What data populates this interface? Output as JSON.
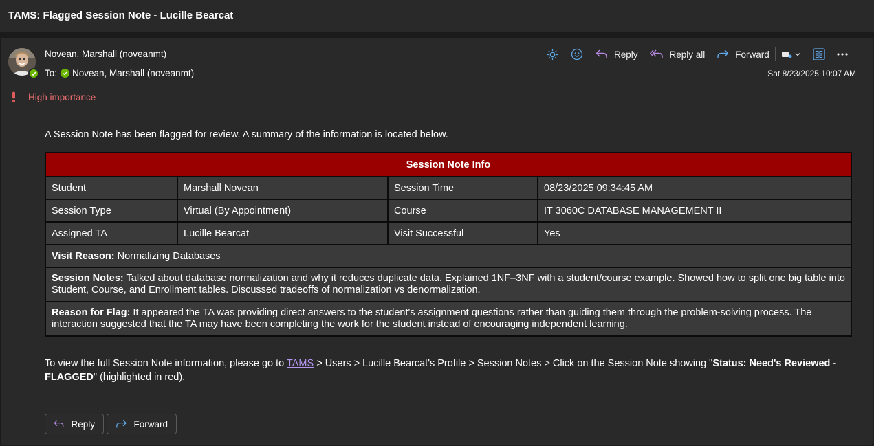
{
  "window": {
    "title": "TAMS: Flagged Session Note - Lucille Bearcat"
  },
  "message": {
    "sender": "Novean, Marshall (noveanmt)",
    "to_label": "To:",
    "recipient": "Novean, Marshall (noveanmt)",
    "date": "Sat 8/23/2025 10:07 AM",
    "importance": "High importance"
  },
  "toolbar": {
    "reply": "Reply",
    "reply_all": "Reply all",
    "forward": "Forward"
  },
  "body": {
    "intro": "A Session Note has been flagged for review. A summary of the information is located below.",
    "table_title": "Session Note Info",
    "rows": [
      {
        "l1": "Student",
        "v1": "Marshall Novean",
        "l2": "Session Time",
        "v2": "08/23/2025 09:34:45 AM"
      },
      {
        "l1": "Session Type",
        "v1": "Virtual (By Appointment)",
        "l2": "Course",
        "v2": "IT 3060C DATABASE MANAGEMENT II"
      },
      {
        "l1": "Assigned TA",
        "v1": "Lucille Bearcat",
        "l2": "Visit Successful",
        "v2": "Yes"
      }
    ],
    "visit_reason_label": "Visit Reason:",
    "visit_reason": " Normalizing Databases",
    "session_notes_label": "Session Notes:",
    "session_notes": " Talked about database normalization and why it reduces duplicate data. Explained 1NF–3NF with a student/course example. Showed how to split one big table into Student, Course, and Enrollment tables. Discussed tradeoffs of normalization vs denormalization.",
    "flag_reason_label": "Reason for Flag:",
    "flag_reason": " It appeared the TA was providing direct answers to the student's assignment questions rather than guiding them through the problem-solving process. The interaction suggested that the TA may have been completing the work for the student instead of encouraging independent learning.",
    "footer_prefix": "To view the full Session Note information, please go to ",
    "footer_link": "TAMS",
    "footer_mid": " > Users > Lucille Bearcat's Profile > Session Notes > Click on the Session Note showing \"",
    "footer_bold": "Status: Need's Reviewed - FLAGGED",
    "footer_suffix": "\" (highlighted in red)."
  },
  "actions": {
    "reply": "Reply",
    "forward": "Forward"
  },
  "colors": {
    "table_header": "#9b0000",
    "importance": "#ee6f6f",
    "link": "#b596f0",
    "presence": "#6bb700"
  },
  "icons": [
    "sun-icon",
    "emoji-icon",
    "reply-icon",
    "reply-all-icon",
    "forward-icon",
    "tag-icon",
    "apps-icon",
    "more-icon",
    "presence-check-icon",
    "exclamation-icon"
  ]
}
